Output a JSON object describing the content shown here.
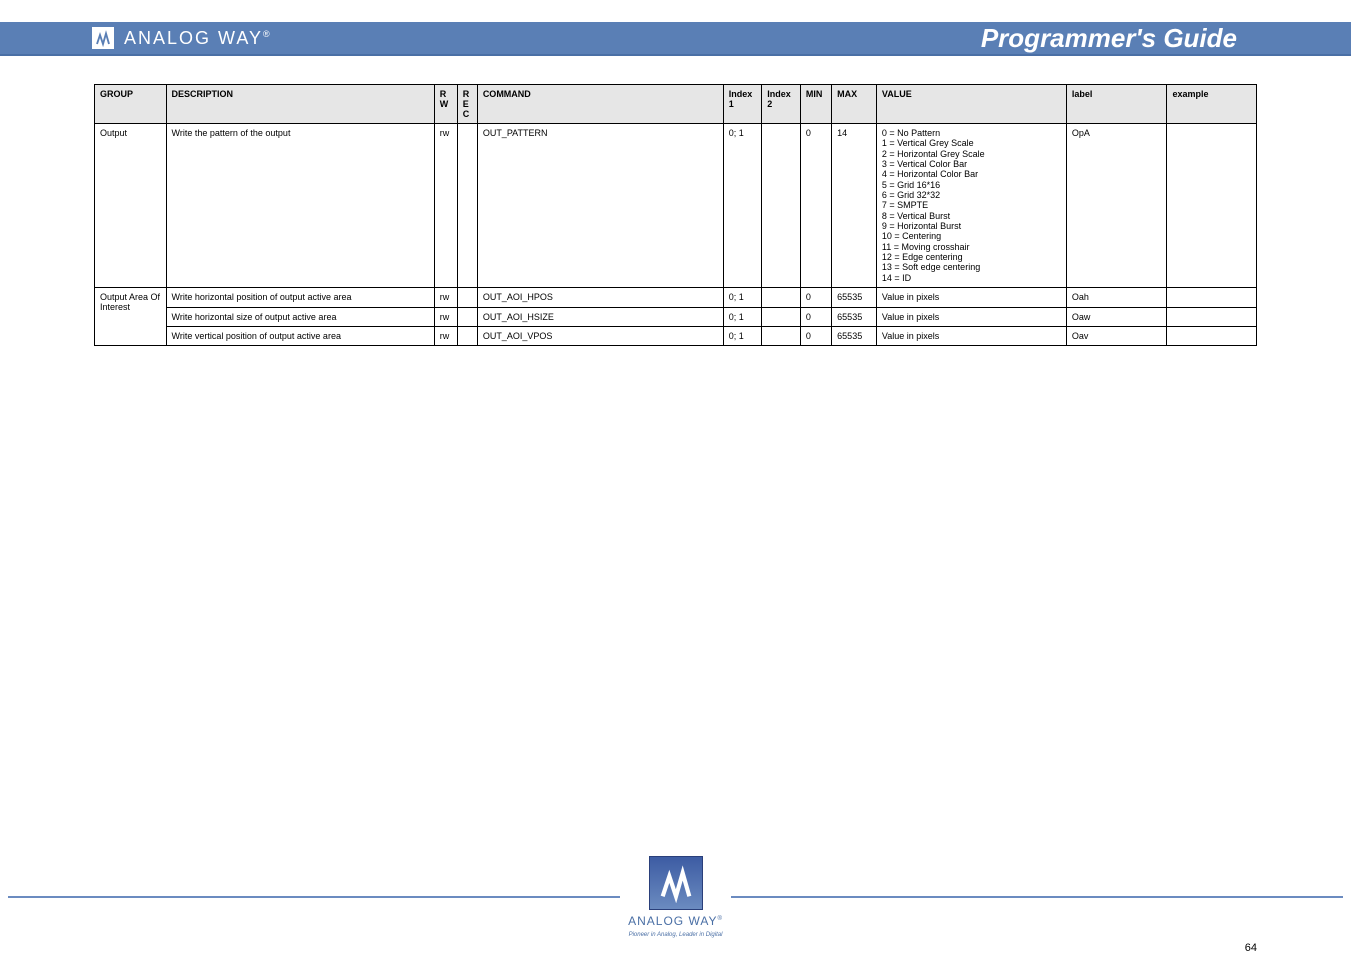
{
  "header": {
    "brand": "ANALOG WAY",
    "reg": "®",
    "title": "Programmer's Guide"
  },
  "table": {
    "headers": [
      "GROUP",
      "DESCRIPTION",
      "R W",
      "R E C",
      "COMMAND",
      "Index 1",
      "Index 2",
      "MIN",
      "MAX",
      "VALUE",
      "label",
      "example"
    ],
    "rows": [
      {
        "group": "Output",
        "group_rowspan": 1,
        "desc": "Write the pattern of the output",
        "rw": "rw",
        "rec": "",
        "cmd": "OUT_PATTERN",
        "idx1": "0; 1",
        "idx2": "",
        "min": "0",
        "max": "14",
        "vals": [
          "0 = No Pattern",
          "1 = Vertical Grey Scale",
          "2 = Horizontal Grey Scale",
          "3 = Vertical Color Bar",
          "4 = Horizontal Color Bar",
          "5 = Grid 16*16",
          "6 = Grid 32*32",
          "7 = SMPTE",
          "8 = Vertical Burst",
          "9 = Horizontal Burst",
          "10 = Centering",
          "11 = Moving crosshair",
          "12 = Edge centering",
          "13 = Soft edge centering",
          "14 = ID"
        ],
        "lbl": "OpA",
        "ex": ""
      },
      {
        "group": "Output Area Of Interest",
        "group_rowspan": 3,
        "desc": "Write horizontal position of output active area",
        "rw": "rw",
        "rec": "",
        "cmd": "OUT_AOI_HPOS",
        "idx1": "0; 1",
        "idx2": "",
        "min": "0",
        "max": "65535",
        "vals": [
          "Value in pixels"
        ],
        "lbl": "Oah",
        "ex": ""
      },
      {
        "group": null,
        "desc": "Write horizontal size of output active area",
        "rw": "rw",
        "rec": "",
        "cmd": "OUT_AOI_HSIZE",
        "idx1": "0; 1",
        "idx2": "",
        "min": "0",
        "max": "65535",
        "vals": [
          "Value in pixels"
        ],
        "lbl": "Oaw",
        "ex": ""
      },
      {
        "group": null,
        "desc": "Write vertical position of output active area",
        "rw": "rw",
        "rec": "",
        "cmd": "OUT_AOI_VPOS",
        "idx1": "0; 1",
        "idx2": "",
        "min": "0",
        "max": "65535",
        "vals": [
          "Value in pixels"
        ],
        "lbl": "Oav",
        "ex": ""
      }
    ]
  },
  "footer": {
    "brand": "ANALOG WAY",
    "tag": "Pioneer in Analog, Leader in Digital",
    "reg": "®"
  },
  "page": {
    "num": "64"
  }
}
